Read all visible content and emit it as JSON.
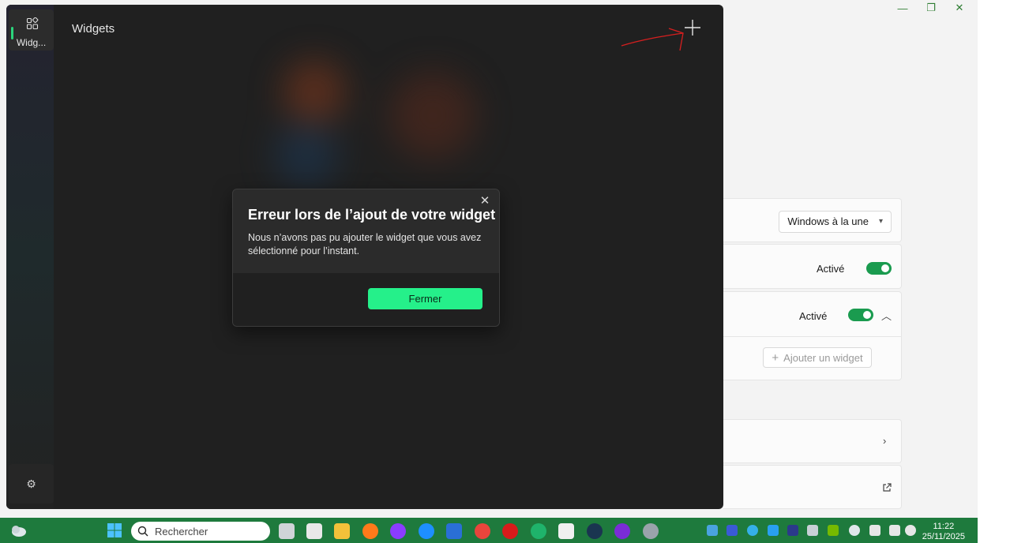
{
  "settings_window": {
    "dropdown_value": "Windows à la une",
    "toggle1_label": "Activé",
    "toggle2_label": "Activé",
    "add_widget_label": "Ajouter un widget"
  },
  "widgets_app": {
    "rail_item_label": "Widg...",
    "title": "Widgets"
  },
  "dialog": {
    "title": "Erreur lors de l’ajout de votre widget",
    "message": "Nous n’avons pas pu ajouter le widget que vous avez sélectionné pour l’instant.",
    "button_label": "Fermer"
  },
  "taskbar": {
    "search_placeholder": "Rechercher",
    "time": "11:22",
    "date": "25/11/2025"
  },
  "colors": {
    "accent": "#25f08a",
    "taskbar": "#1e7a3d",
    "toggle_on": "#1a9b4f"
  }
}
